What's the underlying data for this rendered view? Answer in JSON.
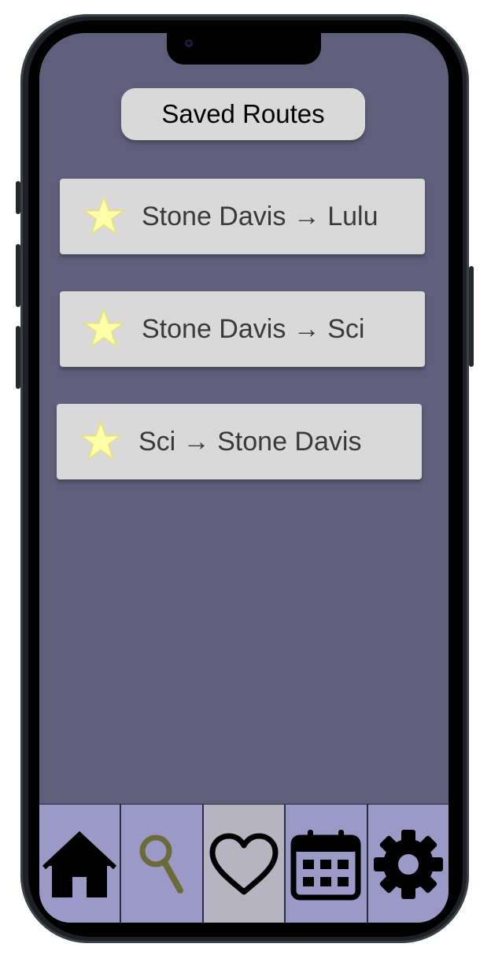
{
  "header": {
    "title": "Saved Routes"
  },
  "routes": [
    {
      "label": "Stone Davis → Lulu",
      "icon": "star-icon",
      "starred": true
    },
    {
      "label": "Stone Davis → Sci",
      "icon": "star-icon",
      "starred": true
    },
    {
      "label": "Sci → Stone Davis",
      "icon": "star-icon",
      "starred": true
    }
  ],
  "tabbar": {
    "active": "saved",
    "tabs": [
      {
        "id": "home",
        "icon": "home-icon"
      },
      {
        "id": "search",
        "icon": "search-icon"
      },
      {
        "id": "saved",
        "icon": "heart-icon"
      },
      {
        "id": "schedule",
        "icon": "calendar-icon"
      },
      {
        "id": "settings",
        "icon": "gear-icon"
      }
    ]
  },
  "colors": {
    "background": "#5f5f7c",
    "card": "#d9d9d9",
    "star_fill": "#ffffaa",
    "star_stroke": "#e6e08a",
    "tab": "#9b99c5",
    "tab_active": "#b5b4c0",
    "search_icon": "#6b6b3a"
  }
}
